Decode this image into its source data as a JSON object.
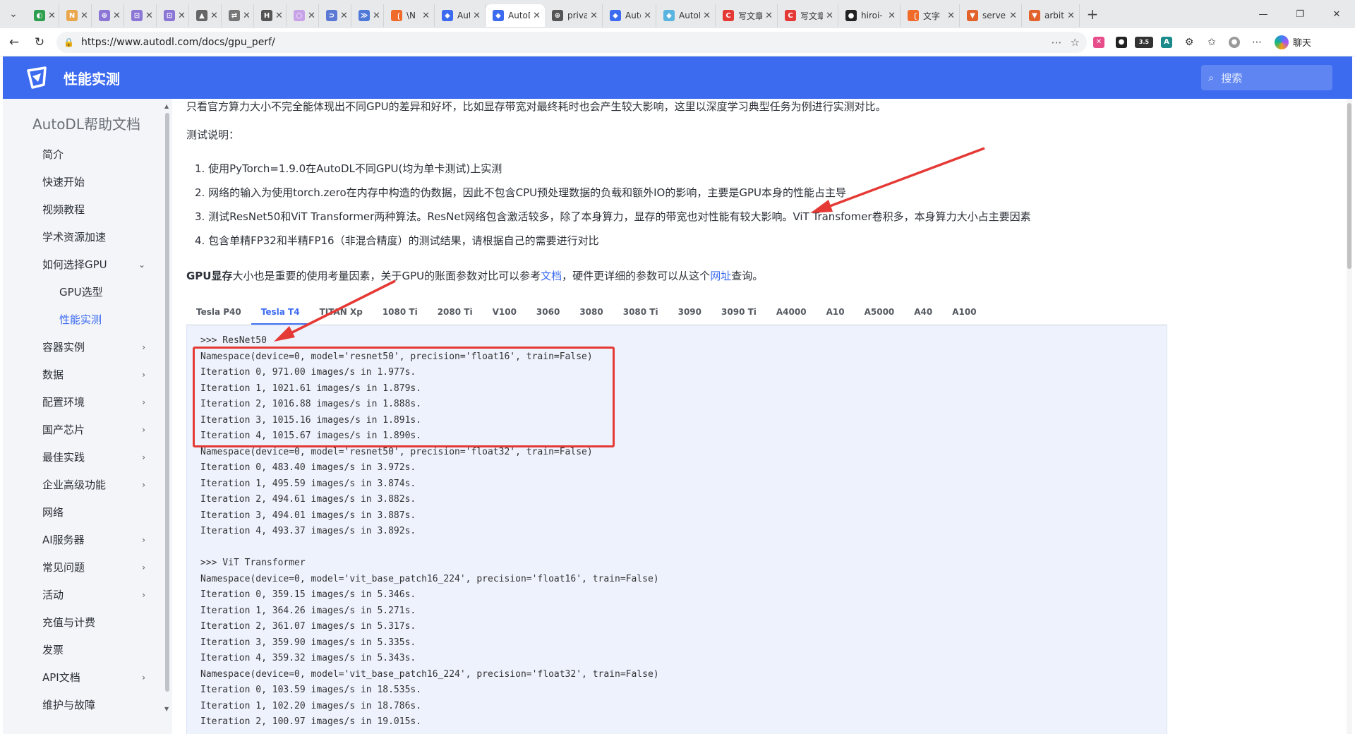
{
  "browser": {
    "tabs": [
      {
        "label": "",
        "color": "#2e9f4e",
        "glyph": "◐"
      },
      {
        "label": "",
        "color": "#e9a64b",
        "glyph": "N"
      },
      {
        "label": "",
        "color": "#8b76d6",
        "glyph": "⊕"
      },
      {
        "label": "",
        "color": "#8b76d6",
        "glyph": "⊡"
      },
      {
        "label": "",
        "color": "#8b76d6",
        "glyph": "⊡"
      },
      {
        "label": "",
        "color": "#666666",
        "glyph": "▲"
      },
      {
        "label": "",
        "color": "#777777",
        "glyph": "⇄"
      },
      {
        "label": "",
        "color": "#555555",
        "glyph": "H"
      },
      {
        "label": "",
        "color": "#c9a3e8",
        "glyph": "○"
      },
      {
        "label": "",
        "color": "#5b7ad6",
        "glyph": "⊃"
      },
      {
        "label": "",
        "color": "#4f79d9",
        "glyph": "≫"
      },
      {
        "label": "\\N",
        "color": "#f06a2a",
        "glyph": "〔"
      },
      {
        "label": "AutoD",
        "color": "#3c6bf0",
        "glyph": "◆"
      },
      {
        "label": "AutoD",
        "color": "#3c6bf0",
        "glyph": "◆",
        "active": true
      },
      {
        "label": "privat",
        "color": "#555555",
        "glyph": "⊕"
      },
      {
        "label": "AutoD",
        "color": "#3c6bf0",
        "glyph": "◆"
      },
      {
        "label": "AutoD",
        "color": "#5ab4e0",
        "glyph": "◆"
      },
      {
        "label": "写文章",
        "color": "#e53935",
        "glyph": "C"
      },
      {
        "label": "写文章",
        "color": "#e53935",
        "glyph": "C"
      },
      {
        "label": "hiroi-",
        "color": "#222222",
        "glyph": "●"
      },
      {
        "label": "文字",
        "color": "#f06a2a",
        "glyph": "〔"
      },
      {
        "label": "server",
        "color": "#e2622c",
        "glyph": "▼"
      },
      {
        "label": "arbitra",
        "color": "#e2622c",
        "glyph": "▼"
      }
    ],
    "url": "https://www.autodl.com/docs/gpu_perf/",
    "chat_label": "聊天"
  },
  "header": {
    "title": "性能实测",
    "search_placeholder": "搜索"
  },
  "sidebar": {
    "title": "AutoDL帮助文档",
    "items": [
      {
        "label": "简介",
        "chevron": ""
      },
      {
        "label": "快速开始",
        "chevron": ""
      },
      {
        "label": "视频教程",
        "chevron": ""
      },
      {
        "label": "学术资源加速",
        "chevron": ""
      },
      {
        "label": "如何选择GPU",
        "chevron": "⌄"
      },
      {
        "label": "GPU选型",
        "chevron": "",
        "sub": true
      },
      {
        "label": "性能实测",
        "chevron": "",
        "sub": true,
        "active": true
      },
      {
        "label": "容器实例",
        "chevron": "›"
      },
      {
        "label": "数据",
        "chevron": "›"
      },
      {
        "label": "配置环境",
        "chevron": "›"
      },
      {
        "label": "国产芯片",
        "chevron": "›"
      },
      {
        "label": "最佳实践",
        "chevron": "›"
      },
      {
        "label": "企业高级功能",
        "chevron": "›"
      },
      {
        "label": "网络",
        "chevron": ""
      },
      {
        "label": "AI服务器",
        "chevron": "›"
      },
      {
        "label": "常见问题",
        "chevron": "›"
      },
      {
        "label": "活动",
        "chevron": "›"
      },
      {
        "label": "充值与计费",
        "chevron": ""
      },
      {
        "label": "发票",
        "chevron": ""
      },
      {
        "label": "API文档",
        "chevron": "›"
      },
      {
        "label": "维护与故障",
        "chevron": ""
      }
    ]
  },
  "content": {
    "intro": "只看官方算力大小不完全能体现出不同GPU的差异和好坏，比如显存带宽对最终耗时也会产生较大影响，这里以深度学习典型任务为例进行实测对比。",
    "test_note": "测试说明：",
    "list": [
      "1. 使用PyTorch=1.9.0在AutoDL不同GPU(均为单卡测试)上实测",
      "2. 网络的输入为使用torch.zero在内存中构造的伪数据，因此不包含CPU预处理数据的负载和额外IO的影响，主要是GPU本身的性能占主导",
      "3. 测试ResNet50和ViT Transformer两种算法。ResNet网络包含激活较多，除了本身算力，显存的带宽也对性能有较大影响。ViT Transfomer卷积多，本身算力大小占主要因素",
      "4. 包含单精FP32和半精FP16（非混合精度）的测试结果，请根据自己的需要进行对比"
    ],
    "gpu_note": {
      "bold": "GPU显存",
      "text1": "大小也是重要的使用考量因素，关于GPU的账面参数对比可以参考",
      "link1": "文档",
      "text2": "，硬件更详细的参数可以从这个",
      "link2": "网址",
      "text3": "查询。"
    },
    "gpu_tabs": [
      "Tesla P40",
      "Tesla T4",
      "TITAN Xp",
      "1080 Ti",
      "2080 Ti",
      "V100",
      "3060",
      "3080",
      "3080 Ti",
      "3090",
      "3090 Ti",
      "A4000",
      "A10",
      "A5000",
      "A40",
      "A100"
    ],
    "active_tab": "Tesla T4",
    "code_lines": [
      ">>> ResNet50",
      "Namespace(device=0, model='resnet50', precision='float16', train=False)",
      "Iteration 0, 971.00 images/s in 1.977s.",
      "Iteration 1, 1021.61 images/s in 1.879s.",
      "Iteration 2, 1016.88 images/s in 1.888s.",
      "Iteration 3, 1015.16 images/s in 1.891s.",
      "Iteration 4, 1015.67 images/s in 1.890s.",
      "Namespace(device=0, model='resnet50', precision='float32', train=False)",
      "Iteration 0, 483.40 images/s in 3.972s.",
      "Iteration 1, 495.59 images/s in 3.874s.",
      "Iteration 2, 494.61 images/s in 3.882s.",
      "Iteration 3, 494.01 images/s in 3.887s.",
      "Iteration 4, 493.37 images/s in 3.892s.",
      "",
      ">>> ViT Transformer",
      "Namespace(device=0, model='vit_base_patch16_224', precision='float16', train=False)",
      "Iteration 0, 359.15 images/s in 5.346s.",
      "Iteration 1, 364.26 images/s in 5.271s.",
      "Iteration 2, 361.07 images/s in 5.317s.",
      "Iteration 3, 359.90 images/s in 5.335s.",
      "Iteration 4, 359.32 images/s in 5.343s.",
      "Namespace(device=0, model='vit_base_patch16_224', precision='float32', train=False)",
      "Iteration 0, 103.59 images/s in 18.535s.",
      "Iteration 1, 102.20 images/s in 18.786s.",
      "Iteration 2, 100.97 images/s in 19.015s."
    ]
  },
  "colors": {
    "brand": "#3c6bf0",
    "annotation": "#e53935"
  }
}
